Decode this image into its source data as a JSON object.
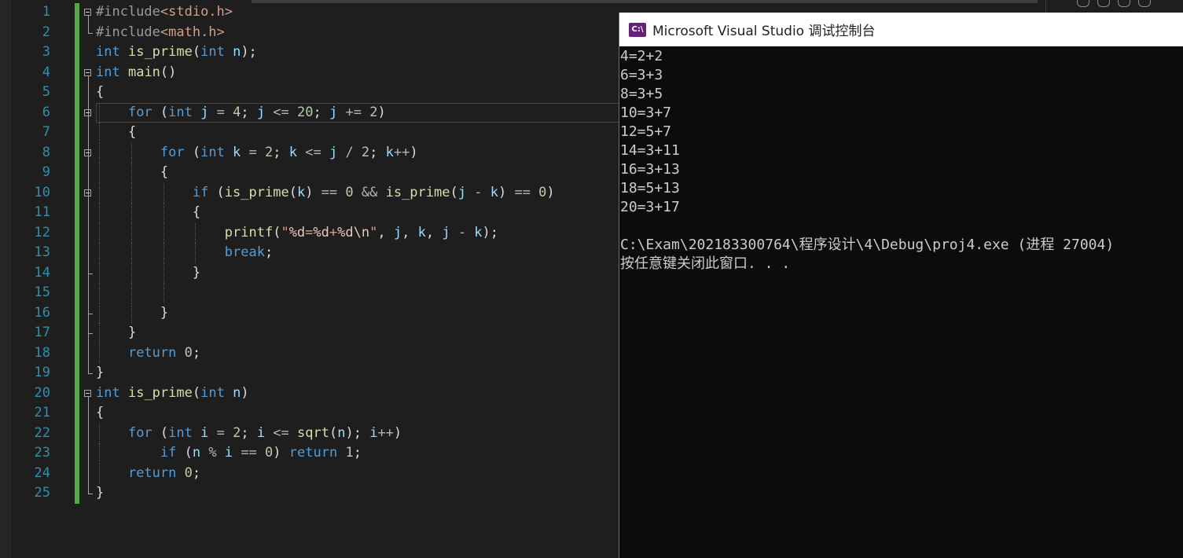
{
  "editor": {
    "line_numbers": [
      "1",
      "2",
      "3",
      "4",
      "5",
      "6",
      "7",
      "8",
      "9",
      "10",
      "11",
      "12",
      "13",
      "14",
      "15",
      "16",
      "17",
      "18",
      "19",
      "20",
      "21",
      "22",
      "23",
      "24",
      "25"
    ],
    "lines": [
      [
        {
          "t": "#include",
          "c": "pp"
        },
        {
          "t": "<stdio.h>",
          "c": "hdr"
        }
      ],
      [
        {
          "t": "#include",
          "c": "pp"
        },
        {
          "t": "<math.h>",
          "c": "hdr"
        }
      ],
      [
        {
          "t": "int",
          "c": "kw"
        },
        {
          "t": " ",
          "c": "pl"
        },
        {
          "t": "is_prime",
          "c": "fn"
        },
        {
          "t": "(",
          "c": "pl"
        },
        {
          "t": "int",
          "c": "kw"
        },
        {
          "t": " n",
          "c": "id"
        },
        {
          "t": ");",
          "c": "pl"
        }
      ],
      [
        {
          "t": "int",
          "c": "kw"
        },
        {
          "t": " ",
          "c": "pl"
        },
        {
          "t": "main",
          "c": "fn"
        },
        {
          "t": "()",
          "c": "pl"
        }
      ],
      [
        {
          "t": "{",
          "c": "pl"
        }
      ],
      [
        {
          "t": "    ",
          "c": "pl"
        },
        {
          "t": "for",
          "c": "kw"
        },
        {
          "t": " (",
          "c": "pl"
        },
        {
          "t": "int",
          "c": "kw"
        },
        {
          "t": " j",
          "c": "id"
        },
        {
          "t": " = ",
          "c": "op"
        },
        {
          "t": "4",
          "c": "num"
        },
        {
          "t": "; ",
          "c": "pl"
        },
        {
          "t": "j",
          "c": "id"
        },
        {
          "t": " <= ",
          "c": "op"
        },
        {
          "t": "20",
          "c": "num"
        },
        {
          "t": "; ",
          "c": "pl"
        },
        {
          "t": "j",
          "c": "id"
        },
        {
          "t": " += ",
          "c": "op"
        },
        {
          "t": "2",
          "c": "num"
        },
        {
          "t": ")",
          "c": "pl"
        }
      ],
      [
        {
          "t": "    {",
          "c": "pl"
        }
      ],
      [
        {
          "t": "        ",
          "c": "pl"
        },
        {
          "t": "for",
          "c": "kw"
        },
        {
          "t": " (",
          "c": "pl"
        },
        {
          "t": "int",
          "c": "kw"
        },
        {
          "t": " k",
          "c": "id"
        },
        {
          "t": " = ",
          "c": "op"
        },
        {
          "t": "2",
          "c": "num"
        },
        {
          "t": "; ",
          "c": "pl"
        },
        {
          "t": "k",
          "c": "id"
        },
        {
          "t": " <= ",
          "c": "op"
        },
        {
          "t": "j",
          "c": "id"
        },
        {
          "t": " / ",
          "c": "op"
        },
        {
          "t": "2",
          "c": "num"
        },
        {
          "t": "; ",
          "c": "pl"
        },
        {
          "t": "k",
          "c": "id"
        },
        {
          "t": "++",
          "c": "op"
        },
        {
          "t": ")",
          "c": "pl"
        }
      ],
      [
        {
          "t": "        {",
          "c": "pl"
        }
      ],
      [
        {
          "t": "            ",
          "c": "pl"
        },
        {
          "t": "if",
          "c": "kw"
        },
        {
          "t": " (",
          "c": "pl"
        },
        {
          "t": "is_prime",
          "c": "fn"
        },
        {
          "t": "(",
          "c": "pl"
        },
        {
          "t": "k",
          "c": "id"
        },
        {
          "t": ")",
          "c": "pl"
        },
        {
          "t": " == ",
          "c": "op"
        },
        {
          "t": "0",
          "c": "num"
        },
        {
          "t": " && ",
          "c": "op"
        },
        {
          "t": "is_prime",
          "c": "fn"
        },
        {
          "t": "(",
          "c": "pl"
        },
        {
          "t": "j",
          "c": "id"
        },
        {
          "t": " - ",
          "c": "op"
        },
        {
          "t": "k",
          "c": "id"
        },
        {
          "t": ")",
          "c": "pl"
        },
        {
          "t": " == ",
          "c": "op"
        },
        {
          "t": "0",
          "c": "num"
        },
        {
          "t": ")",
          "c": "pl"
        }
      ],
      [
        {
          "t": "            {",
          "c": "pl"
        }
      ],
      [
        {
          "t": "                ",
          "c": "pl"
        },
        {
          "t": "printf",
          "c": "fn"
        },
        {
          "t": "(",
          "c": "pl"
        },
        {
          "t": "\"",
          "c": "str"
        },
        {
          "t": "%d",
          "c": "esc"
        },
        {
          "t": "=",
          "c": "str"
        },
        {
          "t": "%d",
          "c": "esc"
        },
        {
          "t": "+",
          "c": "str"
        },
        {
          "t": "%d",
          "c": "esc"
        },
        {
          "t": "\\n",
          "c": "esc"
        },
        {
          "t": "\"",
          "c": "str"
        },
        {
          "t": ", ",
          "c": "pl"
        },
        {
          "t": "j",
          "c": "id"
        },
        {
          "t": ", ",
          "c": "pl"
        },
        {
          "t": "k",
          "c": "id"
        },
        {
          "t": ", ",
          "c": "pl"
        },
        {
          "t": "j",
          "c": "id"
        },
        {
          "t": " - ",
          "c": "op"
        },
        {
          "t": "k",
          "c": "id"
        },
        {
          "t": ");",
          "c": "pl"
        }
      ],
      [
        {
          "t": "                ",
          "c": "pl"
        },
        {
          "t": "break",
          "c": "kw"
        },
        {
          "t": ";",
          "c": "pl"
        }
      ],
      [
        {
          "t": "            }",
          "c": "pl"
        }
      ],
      [
        {
          "t": "",
          "c": "pl"
        }
      ],
      [
        {
          "t": "        }",
          "c": "pl"
        }
      ],
      [
        {
          "t": "    }",
          "c": "pl"
        }
      ],
      [
        {
          "t": "    ",
          "c": "pl"
        },
        {
          "t": "return",
          "c": "kw"
        },
        {
          "t": " ",
          "c": "pl"
        },
        {
          "t": "0",
          "c": "num"
        },
        {
          "t": ";",
          "c": "pl"
        }
      ],
      [
        {
          "t": "}",
          "c": "pl"
        }
      ],
      [
        {
          "t": "int",
          "c": "kw"
        },
        {
          "t": " ",
          "c": "pl"
        },
        {
          "t": "is_prime",
          "c": "fn"
        },
        {
          "t": "(",
          "c": "pl"
        },
        {
          "t": "int",
          "c": "kw"
        },
        {
          "t": " n",
          "c": "id"
        },
        {
          "t": ")",
          "c": "pl"
        }
      ],
      [
        {
          "t": "{",
          "c": "pl"
        }
      ],
      [
        {
          "t": "    ",
          "c": "pl"
        },
        {
          "t": "for",
          "c": "kw"
        },
        {
          "t": " (",
          "c": "pl"
        },
        {
          "t": "int",
          "c": "kw"
        },
        {
          "t": " i",
          "c": "id"
        },
        {
          "t": " = ",
          "c": "op"
        },
        {
          "t": "2",
          "c": "num"
        },
        {
          "t": "; ",
          "c": "pl"
        },
        {
          "t": "i",
          "c": "id"
        },
        {
          "t": " <= ",
          "c": "op"
        },
        {
          "t": "sqrt",
          "c": "fn"
        },
        {
          "t": "(",
          "c": "pl"
        },
        {
          "t": "n",
          "c": "id"
        },
        {
          "t": "); ",
          "c": "pl"
        },
        {
          "t": "i",
          "c": "id"
        },
        {
          "t": "++",
          "c": "op"
        },
        {
          "t": ")",
          "c": "pl"
        }
      ],
      [
        {
          "t": "        ",
          "c": "pl"
        },
        {
          "t": "if",
          "c": "kw"
        },
        {
          "t": " (",
          "c": "pl"
        },
        {
          "t": "n",
          "c": "id"
        },
        {
          "t": " % ",
          "c": "op"
        },
        {
          "t": "i",
          "c": "id"
        },
        {
          "t": " == ",
          "c": "op"
        },
        {
          "t": "0",
          "c": "num"
        },
        {
          "t": ") ",
          "c": "pl"
        },
        {
          "t": "return",
          "c": "kw"
        },
        {
          "t": " ",
          "c": "pl"
        },
        {
          "t": "1",
          "c": "num"
        },
        {
          "t": ";",
          "c": "pl"
        }
      ],
      [
        {
          "t": "    ",
          "c": "pl"
        },
        {
          "t": "return",
          "c": "kw"
        },
        {
          "t": " ",
          "c": "pl"
        },
        {
          "t": "0",
          "c": "num"
        },
        {
          "t": ";",
          "c": "pl"
        }
      ],
      [
        {
          "t": "}",
          "c": "pl"
        }
      ]
    ]
  },
  "console": {
    "title": "Microsoft Visual Studio 调试控制台",
    "icon_label": "C:\\",
    "icon_name": "vs-console-icon",
    "output": [
      "4=2+2",
      "6=3+3",
      "8=3+5",
      "10=3+7",
      "12=5+7",
      "14=3+11",
      "16=3+13",
      "18=5+13",
      "20=3+17",
      "",
      "C:\\Exam\\202183300764\\程序设计\\4\\Debug\\proj4.exe (进程 27004)",
      "按任意键关闭此窗口. . ."
    ]
  },
  "colors": {
    "editor_bg": "#1e1e1e",
    "console_bg": "#0c0c0c",
    "line_number": "#2b91af",
    "change_bar": "#57a64a",
    "keyword": "#569cd6",
    "function": "#dcdcaa"
  }
}
